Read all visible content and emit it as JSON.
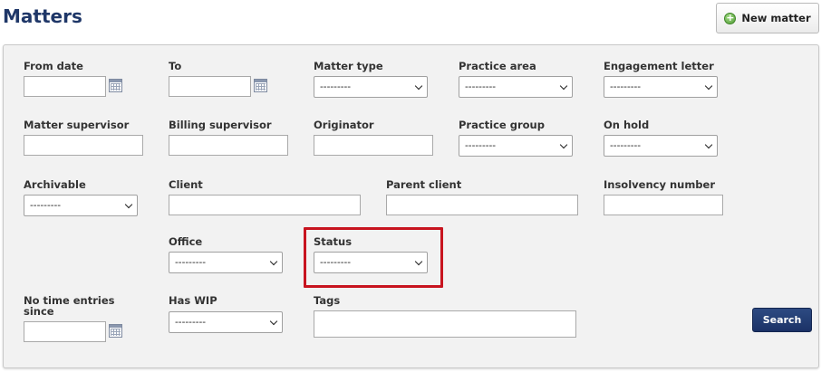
{
  "header": {
    "title": "Matters",
    "new_button_label": "New matter",
    "new_button_icon": "plus-circle-icon"
  },
  "filters": {
    "from_date": {
      "label": "From date",
      "value": ""
    },
    "to": {
      "label": "To",
      "value": ""
    },
    "matter_type": {
      "label": "Matter type",
      "selected": "---------"
    },
    "practice_area": {
      "label": "Practice area",
      "selected": "---------"
    },
    "engagement_letter": {
      "label": "Engagement letter",
      "selected": "---------"
    },
    "matter_supervisor": {
      "label": "Matter supervisor",
      "value": ""
    },
    "billing_supervisor": {
      "label": "Billing supervisor",
      "value": ""
    },
    "originator": {
      "label": "Originator",
      "value": ""
    },
    "practice_group": {
      "label": "Practice group",
      "selected": "---------"
    },
    "on_hold": {
      "label": "On hold",
      "selected": "---------"
    },
    "archivable": {
      "label": "Archivable",
      "selected": "---------"
    },
    "client": {
      "label": "Client",
      "value": ""
    },
    "parent_client": {
      "label": "Parent client",
      "value": ""
    },
    "insolvency_number": {
      "label": "Insolvency number",
      "value": ""
    },
    "office": {
      "label": "Office",
      "selected": "---------"
    },
    "status": {
      "label": "Status",
      "selected": "---------"
    },
    "no_time_entries_since": {
      "label_line1": "No time entries",
      "label_line2": "since",
      "value": ""
    },
    "has_wip": {
      "label": "Has WIP",
      "selected": "---------"
    },
    "tags": {
      "label": "Tags",
      "value": ""
    }
  },
  "search_button_label": "Search",
  "colors": {
    "title": "#1f3768",
    "panel_bg": "#f2f2f2",
    "search_button": "#1f3768",
    "highlight": "#c8141f"
  }
}
